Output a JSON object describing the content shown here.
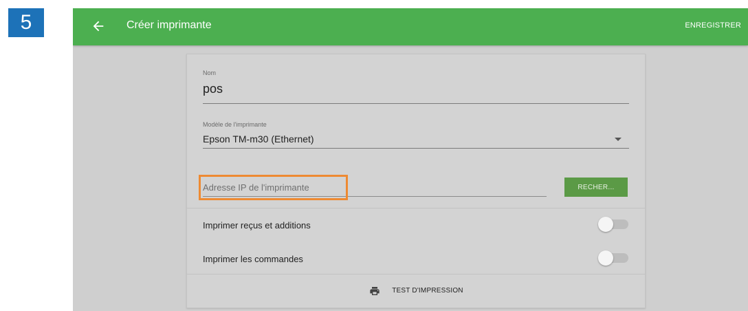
{
  "step": {
    "number": "5",
    "color": "#1d72b8"
  },
  "appbar": {
    "title": "Créer imprimante",
    "save_label": "ENREGISTRER",
    "back_icon": "arrow-left-icon",
    "color": "#4caf50"
  },
  "form": {
    "name": {
      "label": "Nom",
      "value": "pos"
    },
    "model": {
      "label": "Modèle de l'imprimante",
      "value": "Epson TM-m30 (Ethernet)"
    },
    "ip": {
      "placeholder": "Adresse IP de l'imprimante",
      "value": "",
      "highlight_color": "#ee8a32"
    },
    "search_label": "RECHER...",
    "toggles": [
      {
        "label": "Imprimer reçus et additions",
        "on": false
      },
      {
        "label": "Imprimer les commandes",
        "on": false
      }
    ],
    "test_print_label": "TEST D'IMPRESSION",
    "test_print_icon": "printer-icon"
  }
}
